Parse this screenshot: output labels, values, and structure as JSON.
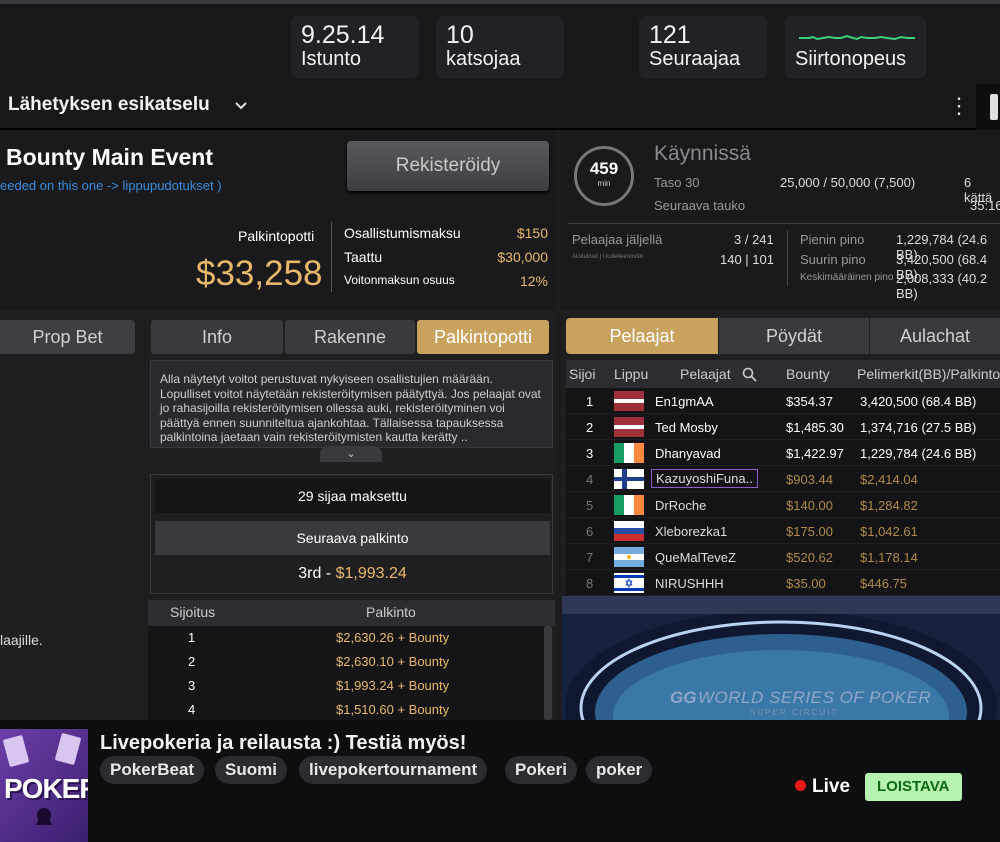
{
  "stats": [
    {
      "value": "9.25.14",
      "label": "Istunto"
    },
    {
      "value": "10",
      "label": "katsojaa"
    },
    {
      "value": "121",
      "label": "Seuraajaa"
    },
    {
      "value": "",
      "label": "Siirtonopeus"
    }
  ],
  "preview": {
    "title": "Lähetyksen esikatselu",
    "more": "⋮"
  },
  "tournament": {
    "title": "Bounty Main Event",
    "subtitle": "eeded on this one -> lippupudotukset )",
    "register_label": "Rekisteröidy",
    "prize_label": "Palkintopotti",
    "prize_value": "$33,258",
    "fees": [
      {
        "k": "Osallistumismaksu",
        "v": "$150"
      },
      {
        "k": "Taattu",
        "v": "$30,000"
      },
      {
        "k": "Voitonmaksun osuus",
        "v": "12%"
      }
    ]
  },
  "status": {
    "timer_value": "459",
    "timer_unit": "min",
    "state": "Käynnissä",
    "level_label": "Taso 30",
    "level_value": "25,000 / 50,000 (7,500)",
    "level_extra": "6 kättä",
    "break_label": "Seuraava tauko",
    "break_value": "35:16",
    "players_left_label": "Pelaajaa jäljellä",
    "players_left_value": "3 / 241",
    "entries_label": "Aloitukset | Uudelleenostot",
    "entries_value": "140 | 101",
    "smallest_label": "Pienin pino",
    "smallest_value": "1,229,784 (24.6 BB)",
    "largest_label": "Suurin pino",
    "largest_value": "3,420,500 (68.4 BB)",
    "avg_label": "Keskimääräinen pino",
    "avg_value": "2,008,333 (40.2 BB)"
  },
  "prop": {
    "button": "Prop Bet",
    "text": "laajille."
  },
  "info_tabs": [
    "Info",
    "Rakenne",
    "Palkintopotti"
  ],
  "info_active": 2,
  "info_desc": "Alla näytetyt voitot perustuvat nykyiseen osallistujien määrään. Lopulliset voitot näytetään rekisteröitymisen päätyttyä. Jos pelaajat ovat jo rahasijoilla rekisteröitymisen ollessa auki, rekisteröityminen voi päättyä ennen suunniteltua ajankohtaa. Tällaisessa tapauksessa palkintoina jaetaan vain rekisteröitymisten kautta kerätty ..",
  "paid": "29 sijaa maksettu",
  "next_label": "Seuraava palkinto",
  "next_place": "3rd",
  "next_sep": "-",
  "next_value": "$1,993.24",
  "payout_head": {
    "place": "Sijoitus",
    "prize": "Palkinto"
  },
  "payouts": [
    {
      "place": "1",
      "prize": "$2,630.26 + Bounty"
    },
    {
      "place": "2",
      "prize": "$2,630.10 + Bounty"
    },
    {
      "place": "3",
      "prize": "$1,993.24 + Bounty"
    },
    {
      "place": "4",
      "prize": "$1,510.60 + Bounty"
    }
  ],
  "player_tabs": [
    "Pelaajat",
    "Pöydät",
    "Aulachat"
  ],
  "player_head": {
    "rank": "Sijoi",
    "flag": "Lippu",
    "name": "Pelaajat",
    "bounty": "Bounty",
    "chips": "Pelimerkit(BB)/Palkinto"
  },
  "players": [
    {
      "rank": "1",
      "flag": "latvia",
      "name": "En1gmAA",
      "bounty": "$354.37",
      "chips": "3,420,500 (68.4 BB)"
    },
    {
      "rank": "2",
      "flag": "latvia",
      "name": "Ted Mosby",
      "bounty": "$1,485.30",
      "chips": "1,374,716 (27.5 BB)"
    },
    {
      "rank": "3",
      "flag": "ireland",
      "name": "Dhanyavad",
      "bounty": "$1,422.97",
      "chips": "1,229,784 (24.6 BB)"
    },
    {
      "rank": "4",
      "flag": "finland",
      "name": "KazuyoshiFuna..",
      "bounty": "$903.44",
      "chips": "$2,414.04"
    },
    {
      "rank": "5",
      "flag": "ireland",
      "name": "DrRoche",
      "bounty": "$140.00",
      "chips": "$1,284.82"
    },
    {
      "rank": "6",
      "flag": "russia",
      "name": "Xleborezka1",
      "bounty": "$175.00",
      "chips": "$1,042.61"
    },
    {
      "rank": "7",
      "flag": "argentina",
      "name": "QueMalTeveZ",
      "bounty": "$520.62",
      "chips": "$1,178.14"
    },
    {
      "rank": "8",
      "flag": "israel",
      "name": "NIRUSHHH",
      "bounty": "$35.00",
      "chips": "$446.75"
    }
  ],
  "table_brand": "WORLD SERIES OF POKER",
  "table_brand_sub": "SUPER CIRCUIT",
  "table_logo": "GG",
  "channel": {
    "avatar_text": "POKER",
    "title": "Livepokeria ja reilausta :) Testiä myös!",
    "tags": [
      "PokerBeat",
      "Suomi",
      "livepokertournament",
      "Pokeri",
      "poker"
    ],
    "live": "Live",
    "badge": "LOISTAVA"
  },
  "colors": {
    "accent_gold": "#c9a35e",
    "prize_gold": "#e8b86a",
    "live_red": "#e91916",
    "badge_green": "#b6f2b0"
  }
}
